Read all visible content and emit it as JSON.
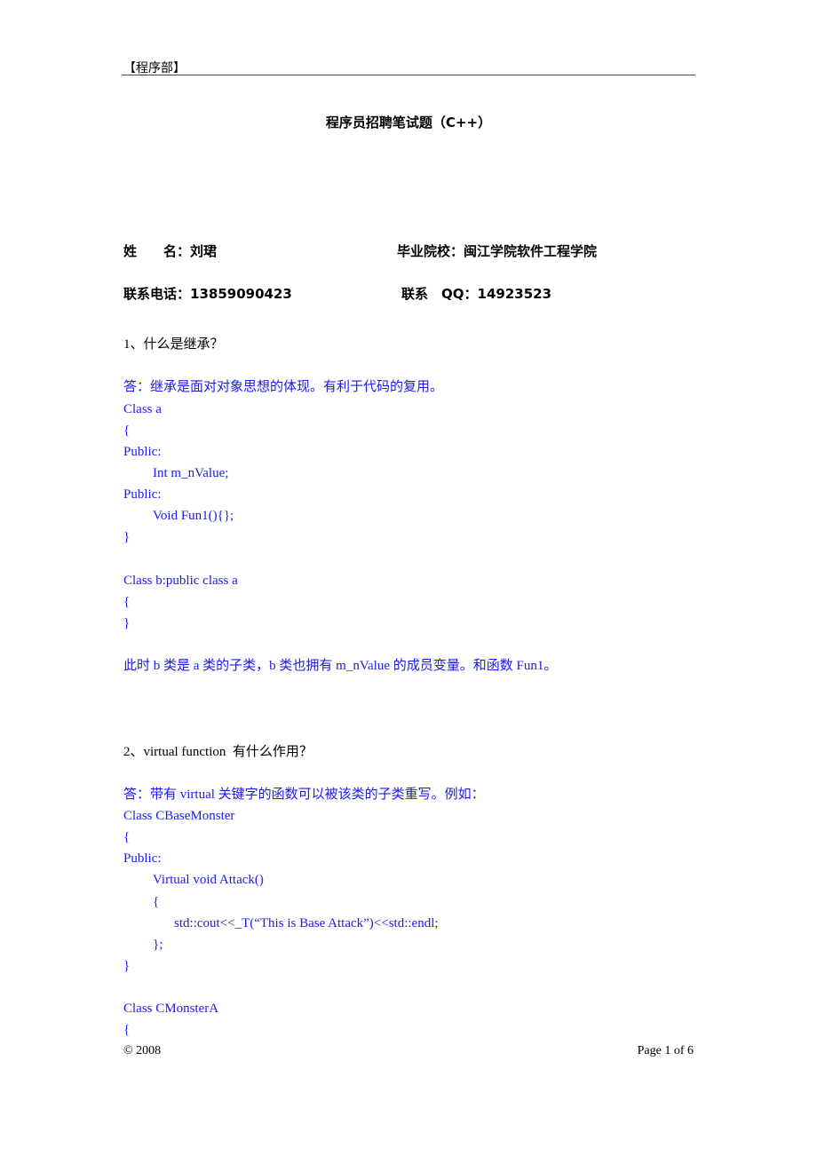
{
  "header": {
    "label": "【程序部】"
  },
  "title": "程序员招聘笔试题（C++）",
  "info": {
    "name_label": "姓　　名：",
    "name_value": "刘珺",
    "school_label": "毕业院校：",
    "school_value": "闽江学院软件工程学院",
    "phone_label": "联系电话：",
    "phone_value": "13859090423",
    "qq_label": "联系　QQ：",
    "qq_value": "14923523"
  },
  "questions": [
    {
      "question": "1、什么是继承？",
      "answer_lines": [
        "答：继承是面对对象思想的体现。有利于代码的复用。",
        "Class a",
        "{",
        "Public:",
        "Int m_nValue;",
        "Public:",
        "Void Fun1(){};",
        "}",
        "Class b:public class a",
        "{",
        "}",
        "此时 b 类是 a 类的子类，b 类也拥有 m_nValue 的成员变量。和函数 Fun1。"
      ]
    },
    {
      "question": "2、virtual function  有什么作用？",
      "answer_lines": [
        "答：带有 virtual 关键字的函数可以被该类的子类重写。例如：",
        "Class CBaseMonster",
        "{",
        "Public:",
        "Virtual void Attack()",
        "{",
        "std::cout<<_T(“This is Base Attack”)<<std::endl;",
        "};",
        "}",
        "Class CMonsterA",
        "{"
      ]
    }
  ],
  "footer": {
    "copyright": "© 2008",
    "page": "Page 1 of 6"
  }
}
